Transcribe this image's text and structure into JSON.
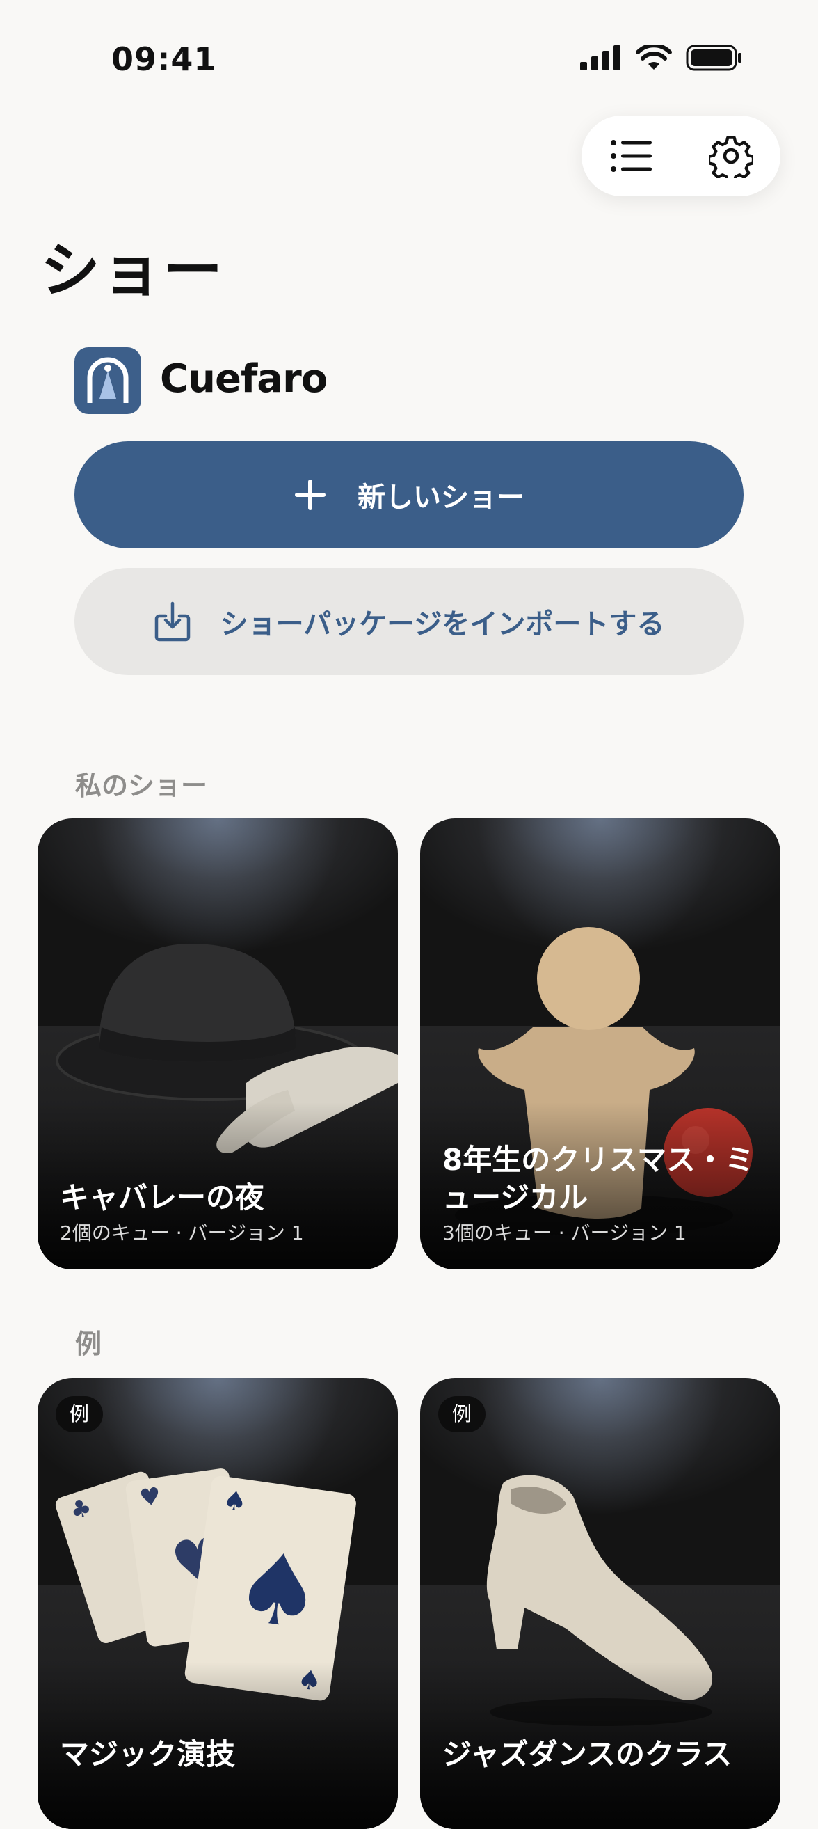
{
  "status_bar": {
    "time": "09:41"
  },
  "header": {
    "title": "ショー"
  },
  "brand": {
    "name": "Cuefaro"
  },
  "actions": {
    "new_show": "新しいショー",
    "import_package": "ショーパッケージをインポートする"
  },
  "sections": {
    "my_shows": {
      "label": "私のショー",
      "cards": [
        {
          "title": "キャバレーの夜",
          "meta": "2個のキュー · バージョン 1"
        },
        {
          "title": "8年生のクリスマス・ミュージカル",
          "meta": "3個のキュー · バージョン 1"
        }
      ]
    },
    "examples": {
      "label": "例",
      "cards": [
        {
          "badge": "例",
          "title": "マジック演技"
        },
        {
          "badge": "例",
          "title": "ジャズダンスのクラス"
        }
      ]
    }
  },
  "colors": {
    "accent": "#3b5e89",
    "background": "#f9f8f6",
    "secondary_button": "#e8e7e5"
  }
}
